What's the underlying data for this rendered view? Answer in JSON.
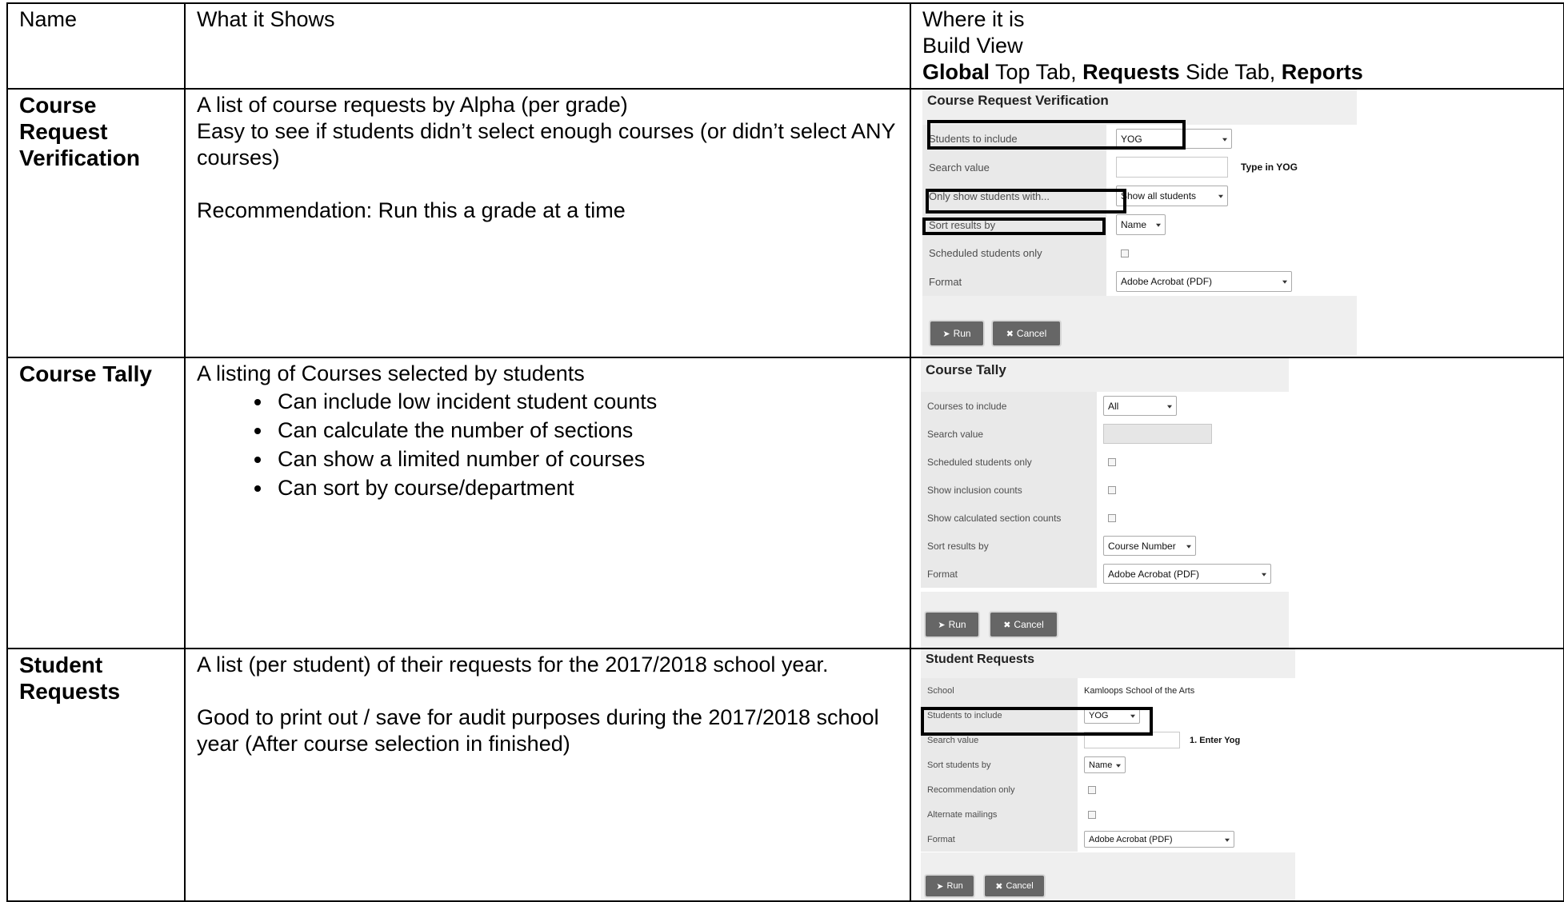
{
  "table": {
    "headers": {
      "name": "Name",
      "what": "What it Shows",
      "where_line1": "Where it is",
      "where_line2": "Build View",
      "where_line3": {
        "p1": "Global",
        "p2": " Top Tab, ",
        "p3": "Requests",
        "p4": " Side Tab, ",
        "p5": "Reports"
      }
    },
    "rows": [
      {
        "name": "Course Request Verification",
        "lines": [
          "A list of course requests by Alpha (per grade)",
          "Easy to see if students didn’t select enough courses (or didn’t select ANY courses)"
        ],
        "recommendation": "Recommendation: Run this a grade at a time"
      },
      {
        "name": "Course Tally",
        "intro": "A listing of Courses selected by students",
        "bullets": [
          "Can include low incident student counts",
          "Can calculate the number of sections",
          "Can show a limited number of courses",
          "Can sort by course/department"
        ]
      },
      {
        "name": "Student Requests",
        "line1": "A list (per student) of their requests for the 2017/2018 school year.",
        "line2": "Good to print out / save for audit purposes during the 2017/2018 school year (After course selection in finished)"
      }
    ]
  },
  "dialogs": {
    "verification": {
      "title": "Course Request Verification",
      "fields": {
        "students_label": "Students to include",
        "students_value": "YOG",
        "search_label": "Search value",
        "search_note": "Type in YOG",
        "only_label": "Only show students with...",
        "only_value": "Show all students",
        "sort_label": "Sort results by",
        "sort_value": "Name",
        "scheduled_label": "Scheduled students only",
        "format_label": "Format",
        "format_value": "Adobe Acrobat (PDF)"
      },
      "run_label": "Run",
      "cancel_label": "Cancel"
    },
    "tally": {
      "title": "Course Tally",
      "fields": {
        "courses_label": "Courses to include",
        "courses_value": "All",
        "search_label": "Search value",
        "scheduled_label": "Scheduled students only",
        "inclusion_label": "Show inclusion counts",
        "section_label": "Show calculated section counts",
        "sort_label": "Sort results by",
        "sort_value": "Course Number",
        "format_label": "Format",
        "format_value": "Adobe Acrobat (PDF)"
      },
      "run_label": "Run",
      "cancel_label": "Cancel"
    },
    "requests": {
      "title": "Student Requests",
      "fields": {
        "school_label": "School",
        "school_value": "Kamloops School of the Arts",
        "students_label": "Students to include",
        "students_value": "YOG",
        "search_label": "Search value",
        "search_note": "1.  Enter Yog",
        "sort_label": "Sort students by",
        "sort_value": "Name",
        "recommendation_label": "Recommendation only",
        "alternate_label": "Alternate mailings",
        "format_label": "Format",
        "format_value": "Adobe Acrobat (PDF)"
      },
      "run_label": "Run",
      "cancel_label": "Cancel"
    }
  }
}
